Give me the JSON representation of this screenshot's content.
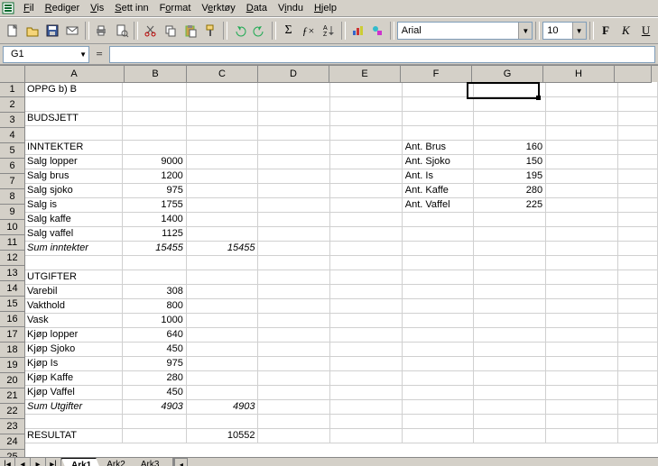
{
  "menu": {
    "items": [
      "Fil",
      "Rediger",
      "Vis",
      "Sett inn",
      "Format",
      "Verktøy",
      "Data",
      "Vindu",
      "Hjelp"
    ]
  },
  "font": {
    "name": "Arial",
    "size": "10",
    "bold_label": "F",
    "italic_label": "K",
    "underline_label": "U"
  },
  "namebox": "G1",
  "fx_symbol": "=",
  "columns": [
    "A",
    "B",
    "C",
    "D",
    "E",
    "F",
    "G",
    "H"
  ],
  "active_cell": {
    "col": "G",
    "row": 1
  },
  "sheets": {
    "active": "Ark1",
    "others": [
      "Ark2",
      "Ark3"
    ]
  },
  "chart_data": {
    "type": "table",
    "title": "OPPG b) B – BUDSJETT",
    "sections": [
      {
        "name": "INNTEKTER",
        "rows": [
          {
            "label": "Salg lopper",
            "value": 9000
          },
          {
            "label": "Salg brus",
            "value": 1200
          },
          {
            "label": "Salg sjoko",
            "value": 975
          },
          {
            "label": "Salg is",
            "value": 1755
          },
          {
            "label": "Salg kaffe",
            "value": 1400
          },
          {
            "label": "Salg vaffel",
            "value": 1125
          }
        ],
        "sum_label": "Sum inntekter",
        "sum_B": 15455,
        "sum_C": 15455
      },
      {
        "name": "UTGIFTER",
        "rows": [
          {
            "label": "Varebil",
            "value": 308
          },
          {
            "label": "Vakthold",
            "value": 800
          },
          {
            "label": "Vask",
            "value": 1000
          },
          {
            "label": "Kjøp lopper",
            "value": 640
          },
          {
            "label": "Kjøp Sjoko",
            "value": 450
          },
          {
            "label": "Kjøp Is",
            "value": 975
          },
          {
            "label": "Kjøp Kaffe",
            "value": 280
          },
          {
            "label": "Kjøp Vaffel",
            "value": 450
          }
        ],
        "sum_label": "Sum Utgifter",
        "sum_B": 4903,
        "sum_C": 4903
      }
    ],
    "resultat_label": "RESULTAT",
    "resultat_value": 10552,
    "antall": [
      {
        "label": "Ant. Brus",
        "value": 160
      },
      {
        "label": "Ant. Sjoko",
        "value": 150
      },
      {
        "label": "Ant. Is",
        "value": 195
      },
      {
        "label": "Ant. Kaffe",
        "value": 280
      },
      {
        "label": "Ant. Vaffel",
        "value": 225
      }
    ]
  },
  "cells": {
    "A1": "OPPG b) B",
    "A3": "BUDSJETT",
    "A5": "INNTEKTER",
    "A6": "Salg lopper",
    "B6": "9000",
    "A7": "Salg brus",
    "B7": "1200",
    "A8": "Salg sjoko",
    "B8": "975",
    "A9": "Salg is",
    "B9": "1755",
    "A10": "Salg kaffe",
    "B10": "1400",
    "A11": "Salg vaffel",
    "B11": "1125",
    "A12": "Sum inntekter",
    "B12": "15455",
    "C12": "15455",
    "A14": "UTGIFTER",
    "A15": "Varebil",
    "B15": "308",
    "A16": "Vakthold",
    "B16": "800",
    "A17": "Vask",
    "B17": "1000",
    "A18": "Kjøp lopper",
    "B18": "640",
    "A19": "Kjøp Sjoko",
    "B19": "450",
    "A20": "Kjøp Is",
    "B20": "975",
    "A21": "Kjøp Kaffe",
    "B21": "280",
    "A22": "Kjøp Vaffel",
    "B22": "450",
    "A23": "Sum Utgifter",
    "B23": "4903",
    "C23": "4903",
    "A25": "RESULTAT",
    "C25": "10552",
    "F5": "Ant. Brus",
    "G5": "160",
    "F6": "Ant. Sjoko",
    "G6": "150",
    "F7": "Ant. Is",
    "G7": "195",
    "F8": "Ant. Kaffe",
    "G8": "280",
    "F9": "Ant. Vaffel",
    "G9": "225"
  }
}
